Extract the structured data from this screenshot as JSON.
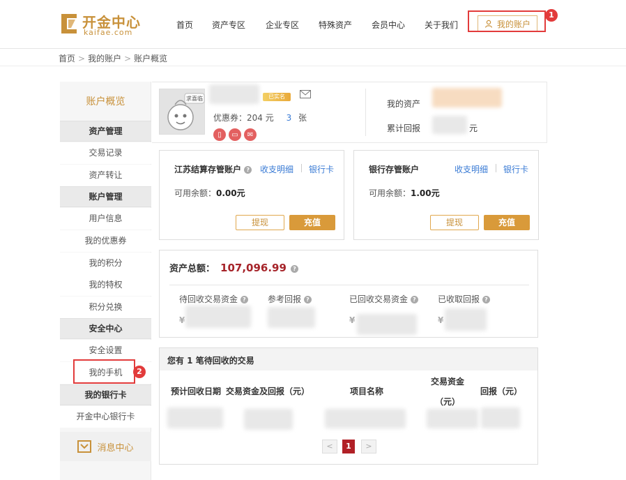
{
  "brand": {
    "name": "开金中心",
    "domain": "kaifae.com",
    "color": "#c8913a"
  },
  "nav": [
    "首页",
    "资产专区",
    "企业专区",
    "特殊资产",
    "会员中心",
    "关于我们"
  ],
  "account_button": "我的账户",
  "annotations": {
    "badge1": "1",
    "badge2": "2"
  },
  "breadcrumb": [
    "首页",
    "我的账户",
    "账户概览"
  ],
  "sidebar": {
    "title": "账户概览",
    "sections": [
      {
        "label": "资产管理",
        "items": [
          "交易记录",
          "资产转让"
        ]
      },
      {
        "label": "账户管理",
        "items": [
          "用户信息",
          "我的优惠券",
          "我的积分",
          "我的特权",
          "积分兑换"
        ]
      },
      {
        "label": "安全中心",
        "items": [
          "安全设置",
          "我的手机"
        ]
      },
      {
        "label": "我的银行卡",
        "items": [
          "开金中心银行卡"
        ]
      }
    ],
    "message_center": "消息中心"
  },
  "profile": {
    "avatar_text": "求喜临",
    "vip_label": "已实名",
    "coupon_label": "优惠券：204 元",
    "coupon_count": "3",
    "coupon_unit": "张",
    "my_assets_label": "我的资产",
    "cumulative_return_label": "累计回报",
    "cumulative_unit": "元"
  },
  "accounts": [
    {
      "title": "江苏结算存管账户",
      "links": [
        "收支明细",
        "银行卡"
      ],
      "available_label": "可用余额：",
      "available_value": "0.00元",
      "withdraw": "提现",
      "deposit": "充值"
    },
    {
      "title": "银行存管账户",
      "links": [
        "收支明细",
        "银行卡"
      ],
      "available_label": "可用余额：",
      "available_value": "1.00元",
      "withdraw": "提现",
      "deposit": "充值"
    }
  ],
  "assets": {
    "total_label": "资产总额：",
    "total_value": "107,096.99",
    "metrics": [
      "待回收交易资金",
      "参考回报",
      "已回收交易资金",
      "已收取回报"
    ],
    "yen": "¥"
  },
  "trades": {
    "title": "您有 1 笔待回收的交易",
    "columns": [
      "预计回收日期",
      "交易资金及回报（元）",
      "项目名称",
      "交易资金",
      "（元）",
      "回报（元）"
    ],
    "pager": {
      "prev": "<",
      "current": "1",
      "next": ">"
    }
  },
  "colors": {
    "accent": "#c8913a",
    "highlight": "#e23b3b",
    "link": "#3a7bd5",
    "total": "#a6242a"
  }
}
